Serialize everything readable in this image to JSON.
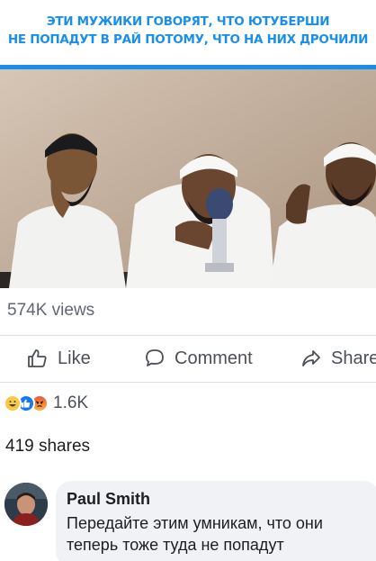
{
  "caption": {
    "line1": "ЭТИ МУЖИКИ ГОВОРЯТ, ЧТО ЮТУБЕРШИ",
    "line2": "НЕ ПОПАДУТ В РАЙ ПОТОМУ, ЧТО НА НИХ ДРОЧИЛИ",
    "color": "#1b8fe8"
  },
  "post": {
    "views": "574K views"
  },
  "actions": {
    "like": "Like",
    "comment": "Comment",
    "share": "Share"
  },
  "reactions": {
    "icons": [
      "haha-icon",
      "like-icon",
      "angry-icon"
    ],
    "count": "1.6K"
  },
  "shares": "419 shares",
  "comment": {
    "author": "Paul Smith",
    "text": "Передайте этим умникам, что они теперь тоже туда не попадут"
  }
}
